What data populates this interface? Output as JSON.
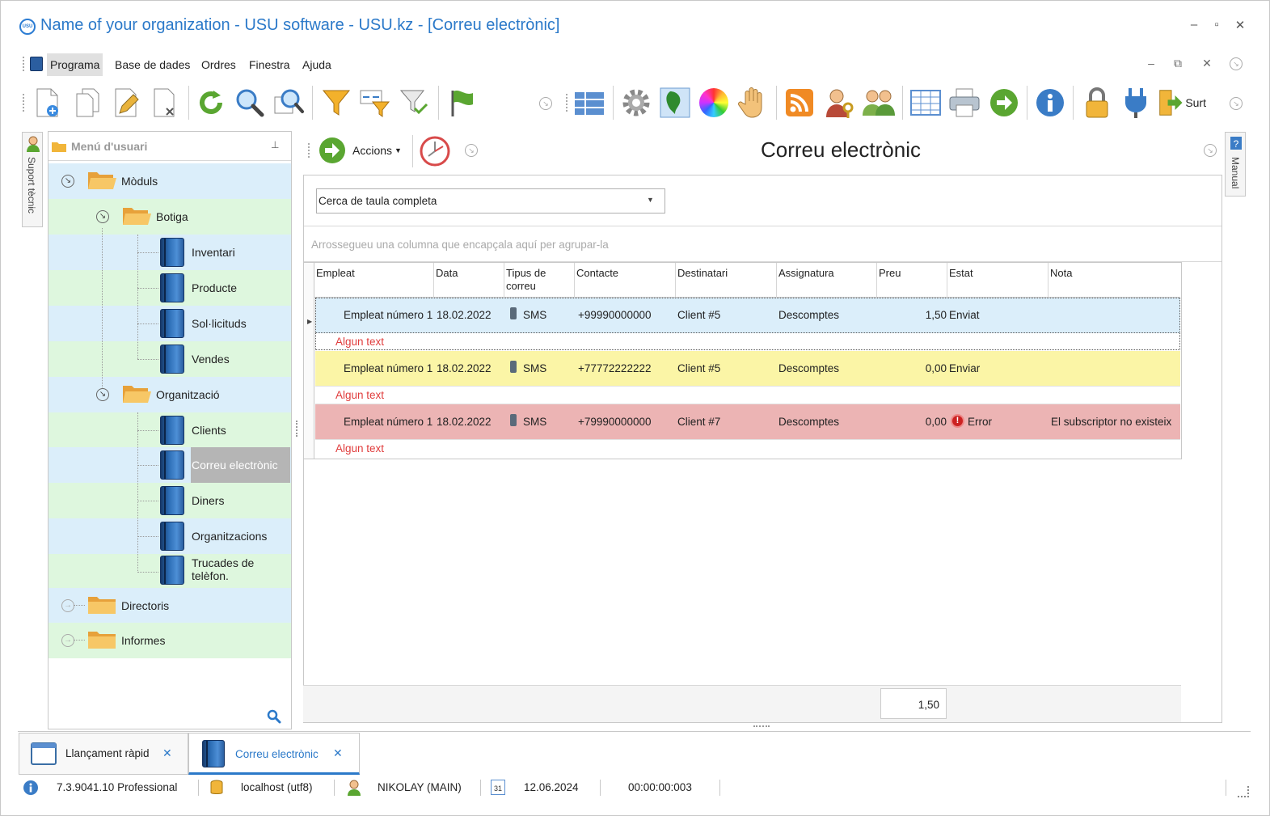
{
  "window": {
    "title": "Name of your organization - USU software - USU.kz - [Correu electrònic]",
    "logo_text": "USU",
    "controls": [
      "–",
      "▫",
      "✕"
    ]
  },
  "menu": {
    "items": [
      "Programa",
      "Base de dades",
      "Ordres",
      "Finestra",
      "Ajuda"
    ],
    "mdi_controls": [
      "–",
      "⧉",
      "✕"
    ]
  },
  "toolbar": {
    "exit_label": "Surt"
  },
  "side_tabs": {
    "left": "Suport tècnic",
    "right": "Manual"
  },
  "user_menu": {
    "title": "Menú d'usuari",
    "pin": "⊥",
    "tree": {
      "modules": "Mòduls",
      "shop": "Botiga",
      "inventory": "Inventari",
      "product": "Producte",
      "requests": "Sol·licituds",
      "sales": "Vendes",
      "organization": "Organització",
      "clients": "Clients",
      "email": "Correu electrònic",
      "money": "Diners",
      "organizations": "Organitzacions",
      "calls": "Trucades de telèfon.",
      "directories": "Directoris",
      "reports": "Informes"
    }
  },
  "main": {
    "actions_label": "Accions",
    "page_title": "Correu electrònic",
    "search_scope": "Cerca de taula completa",
    "group_hint": "Arrossegueu una columna que encapçala aquí per agrupar-la",
    "columns": [
      "Empleat",
      "Data",
      "Tipus de correu",
      "Contacte",
      "Destinatari",
      "Assignatura",
      "Preu",
      "Estat",
      "Nota"
    ],
    "rows": [
      {
        "employee": "Empleat número 1",
        "date": "18.02.2022",
        "type": "SMS",
        "contact": "+99990000000",
        "recipient": "Client #5",
        "subject": "Descomptes",
        "price": "1,50",
        "status": "Enviat",
        "note": "",
        "subtext": "Algun text"
      },
      {
        "employee": "Empleat número 1",
        "date": "18.02.2022",
        "type": "SMS",
        "contact": "+77772222222",
        "recipient": "Client #5",
        "subject": "Descomptes",
        "price": "0,00",
        "status": "Enviar",
        "note": "",
        "subtext": "Algun text"
      },
      {
        "employee": "Empleat número 1",
        "date": "18.02.2022",
        "type": "SMS",
        "contact": "+79990000000",
        "recipient": "Client #7",
        "subject": "Descomptes",
        "price": "0,00",
        "status": "Error",
        "note": "El subscriptor no existeix",
        "subtext": "Algun text"
      }
    ],
    "total": "1,50",
    "row_colors": [
      "#dbeefa",
      "#fbf5a6",
      "#ecb4b4"
    ]
  },
  "doc_tabs": [
    {
      "label": "Llançament ràpid",
      "close": "✕"
    },
    {
      "label": "Correu electrònic",
      "close": "✕"
    }
  ],
  "statusbar": {
    "version": "7.3.9041.10 Professional",
    "server": "localhost (utf8)",
    "user": "NIKOLAY (MAIN)",
    "calendar_day": "31",
    "date": "12.06.2024",
    "timer": "00:00:00:003"
  },
  "colors": {
    "accent": "#2b79c9",
    "error_text": "#e03c3c",
    "tree_blue": "#dbeefa",
    "tree_green": "#def7de",
    "selected": "#b5b5b5"
  }
}
